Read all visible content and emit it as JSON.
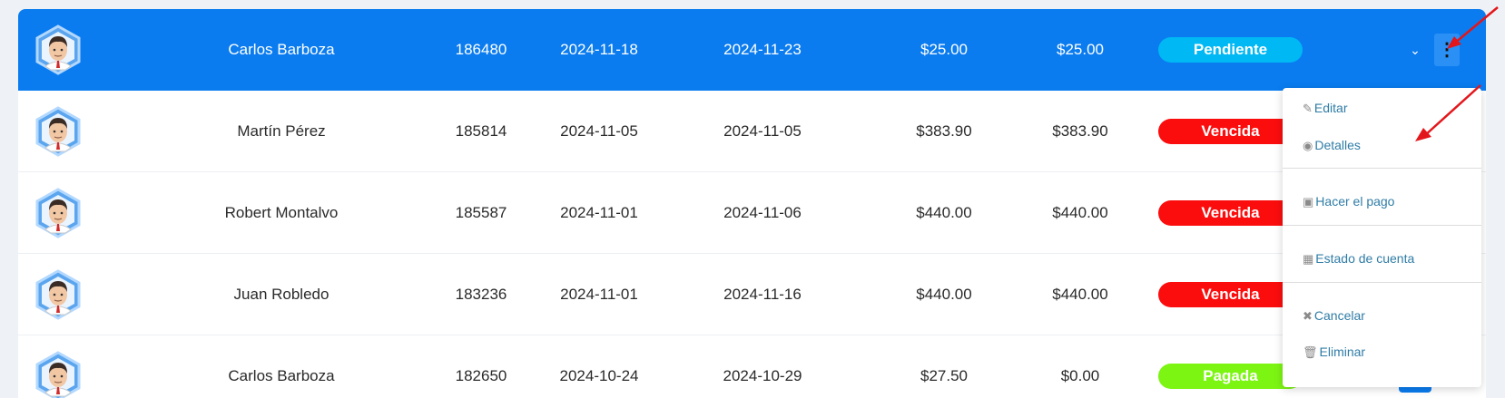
{
  "rows": [
    {
      "name": "Carlos Barboza",
      "number": "186480",
      "date_issued": "2024-11-18",
      "date_due": "2024-11-23",
      "total": "$25.00",
      "balance": "$25.00",
      "status": "Pendiente",
      "status_color": "#00b8f4",
      "selected": true
    },
    {
      "name": "Martín Pérez",
      "number": "185814",
      "date_issued": "2024-11-05",
      "date_due": "2024-11-05",
      "total": "$383.90",
      "balance": "$383.90",
      "status": "Vencida",
      "status_color": "#fb0d0d",
      "selected": false
    },
    {
      "name": "Robert Montalvo",
      "number": "185587",
      "date_issued": "2024-11-01",
      "date_due": "2024-11-06",
      "total": "$440.00",
      "balance": "$440.00",
      "status": "Vencida",
      "status_color": "#fb0d0d",
      "selected": false
    },
    {
      "name": "Juan Robledo",
      "number": "183236",
      "date_issued": "2024-11-01",
      "date_due": "2024-11-16",
      "total": "$440.00",
      "balance": "$440.00",
      "status": "Vencida",
      "status_color": "#fb0d0d",
      "selected": false
    },
    {
      "name": "Carlos Barboza",
      "number": "182650",
      "date_issued": "2024-10-24",
      "date_due": "2024-10-29",
      "total": "$27.50",
      "balance": "$0.00",
      "status": "Pagada",
      "status_color": "#7cf513",
      "selected": false
    }
  ],
  "menu": {
    "editar": {
      "label": "Editar",
      "icon": "edit-icon"
    },
    "detalles": {
      "label": "Detalles",
      "icon": "eye-icon"
    },
    "pago": {
      "label": "Hacer el pago",
      "icon": "money-icon"
    },
    "estado": {
      "label": "Estado de cuenta",
      "icon": "file-icon"
    },
    "cancelar": {
      "label": "Cancelar",
      "icon": "x-icon"
    },
    "eliminar": {
      "label": "Eliminar",
      "icon": "trash-icon"
    }
  },
  "colors": {
    "selected_row": "#0a7cf0",
    "menu_link": "#2f7ca6",
    "annotation_arrow": "#e3161b"
  }
}
